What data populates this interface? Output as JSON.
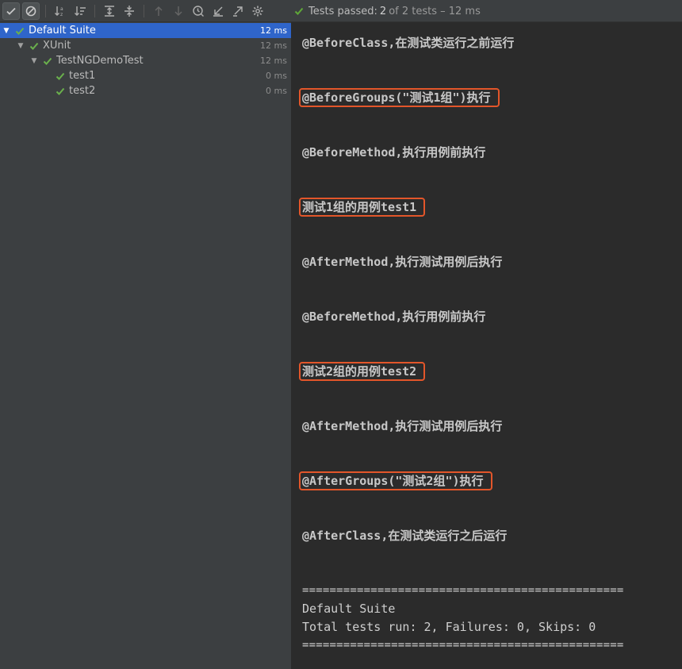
{
  "toolbar": {
    "buttons": [
      {
        "name": "show-passed-button",
        "icon": "check-icon"
      },
      {
        "name": "show-ignored-button",
        "icon": "ignored-icon"
      },
      {
        "name": "sort-alphabetically-button",
        "icon": "sort-alpha-icon"
      },
      {
        "name": "sort-by-duration-button",
        "icon": "sort-duration-icon"
      },
      {
        "name": "expand-all-button",
        "icon": "expand-all-icon"
      },
      {
        "name": "collapse-all-button",
        "icon": "collapse-all-icon"
      },
      {
        "name": "previous-failed-button",
        "icon": "arrow-up-icon"
      },
      {
        "name": "next-failed-button",
        "icon": "arrow-down-icon"
      },
      {
        "name": "test-history-button",
        "icon": "history-icon"
      },
      {
        "name": "import-tests-button",
        "icon": "import-icon"
      },
      {
        "name": "export-tests-button",
        "icon": "export-icon"
      },
      {
        "name": "settings-button",
        "icon": "gear-icon"
      }
    ]
  },
  "status": {
    "label": "Tests passed:",
    "passed": "2",
    "rest": "of 2 tests – 12 ms",
    "color": "#5fa838"
  },
  "tree": [
    {
      "label": "Default Suite",
      "time": "12 ms",
      "selected": true,
      "depth": 0,
      "expandable": true
    },
    {
      "label": "XUnit",
      "time": "12 ms",
      "selected": false,
      "depth": 1,
      "expandable": true
    },
    {
      "label": "TestNGDemoTest",
      "time": "12 ms",
      "selected": false,
      "depth": 2,
      "expandable": true
    },
    {
      "label": "test1",
      "time": "0 ms",
      "selected": false,
      "depth": 3,
      "expandable": false
    },
    {
      "label": "test2",
      "time": "0 ms",
      "selected": false,
      "depth": 3,
      "expandable": false
    }
  ],
  "console": {
    "lines": [
      {
        "text": "@BeforeClass,在测试类运行之前运行",
        "highlight": false
      },
      {
        "text": "@BeforeGroups(\"测试1组\")执行",
        "highlight": true
      },
      {
        "text": "@BeforeMethod,执行用例前执行",
        "highlight": false
      },
      {
        "text": "测试1组的用例test1",
        "highlight": true
      },
      {
        "text": "@AfterMethod,执行测试用例后执行",
        "highlight": false
      },
      {
        "text": "@BeforeMethod,执行用例前执行",
        "highlight": false
      },
      {
        "text": "测试2组的用例test2",
        "highlight": true
      },
      {
        "text": "@AfterMethod,执行测试用例后执行",
        "highlight": false
      },
      {
        "text": "@AfterGroups(\"测试2组\")执行",
        "highlight": true
      },
      {
        "text": "@AfterClass,在测试类运行之后运行",
        "highlight": false
      }
    ],
    "summary": {
      "rule": "===============================================",
      "suite": "Default Suite",
      "totals": "Total tests run: 2, Failures: 0, Skips: 0"
    },
    "highlight_color": "#e3562a"
  }
}
